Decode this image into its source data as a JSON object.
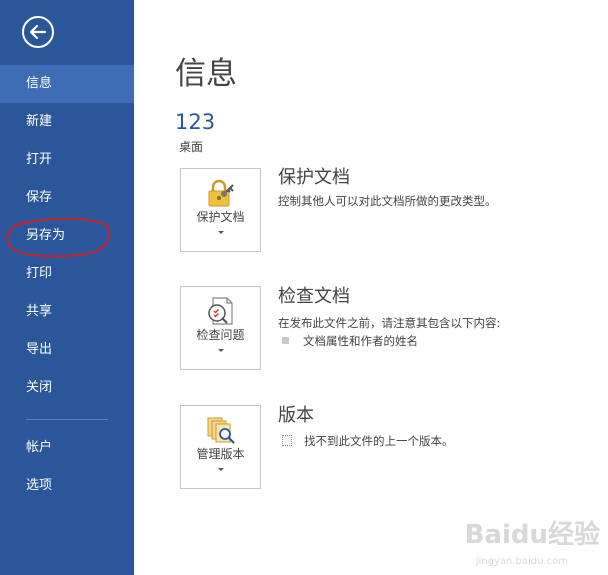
{
  "sidebar": {
    "items": [
      {
        "label": "信息"
      },
      {
        "label": "新建"
      },
      {
        "label": "打开"
      },
      {
        "label": "保存"
      },
      {
        "label": "另存为"
      },
      {
        "label": "打印"
      },
      {
        "label": "共享"
      },
      {
        "label": "导出"
      },
      {
        "label": "关闭"
      },
      {
        "label": "帐户"
      },
      {
        "label": "选项"
      }
    ],
    "active_index": 0,
    "annotation_color": "#d21d1d"
  },
  "main": {
    "title": "信息",
    "document_name": "123",
    "document_location": "桌面",
    "protect": {
      "button_label": "保护文档",
      "title": "保护文档",
      "description": "控制其他人可以对此文档所做的更改类型。"
    },
    "inspect": {
      "button_label": "检查问题",
      "title": "检查文档",
      "description": "在发布此文件之前，请注意其包含以下内容:",
      "bullets": [
        "文档属性和作者的姓名"
      ]
    },
    "versions": {
      "button_label": "管理版本",
      "title": "版本",
      "description": "找不到此文件的上一个版本。"
    }
  },
  "watermark": {
    "brand": "Baidu经验",
    "url": "jingyan.baidu.com"
  },
  "colors": {
    "sidebar_bg": "#2b579a",
    "sidebar_active": "#3e6db5",
    "accent": "#2b579a"
  }
}
